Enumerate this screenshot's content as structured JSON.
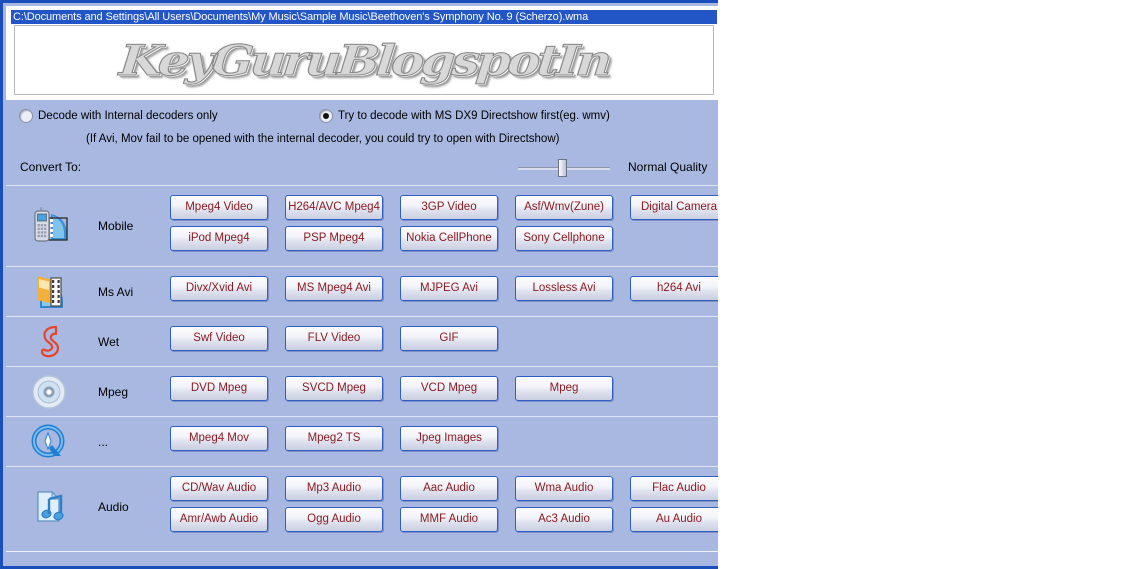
{
  "window": {
    "title_path": "C:\\Documents and Settings\\All Users\\Documents\\My Music\\Sample Music\\Beethoven's Symphony No. 9 (Scherzo).wma",
    "watermark": "KeyGuruBlogspotIn",
    "accent_color": "#2255c5",
    "border_color": "#1a4fbb",
    "panel_color": "#a8b8e0",
    "button_text_color": "#8b1a22"
  },
  "options": {
    "internal_decoder": {
      "label": "Decode with Internal decoders only",
      "checked": false
    },
    "directshow_decoder": {
      "label": "Try to decode with MS DX9 Directshow first(eg. wmv)",
      "checked": true
    },
    "hint": "(If Avi, Mov fail to be opened with the internal decoder, you could try to open with Directshow)",
    "convert_to_label": "Convert To:",
    "quality_label": "Normal Quality",
    "quality_slider_percent": 48
  },
  "categories": [
    {
      "name": "Mobile",
      "icon": "mobile-phone-film-icon",
      "rows": [
        [
          "Mpeg4 Video",
          "H264/AVC Mpeg4",
          "3GP Video",
          "Asf/Wmv(Zune)",
          "Digital Camera"
        ],
        [
          "iPod Mpeg4",
          "PSP Mpeg4",
          "Nokia CellPhone",
          "Sony Cellphone"
        ]
      ]
    },
    {
      "name": "Ms Avi",
      "icon": "avi-film-icon",
      "rows": [
        [
          "Divx/Xvid Avi",
          "MS Mpeg4 Avi",
          "MJPEG Avi",
          "Lossless Avi",
          "h264 Avi"
        ]
      ]
    },
    {
      "name": "Wet",
      "icon": "flash-icon",
      "rows": [
        [
          "Swf Video",
          "FLV Video",
          "GIF"
        ]
      ]
    },
    {
      "name": "Mpeg",
      "icon": "disc-icon",
      "rows": [
        [
          "DVD Mpeg",
          "SVCD Mpeg",
          "VCD Mpeg",
          "Mpeg"
        ]
      ]
    },
    {
      "name": "...",
      "icon": "quicktime-icon",
      "rows": [
        [
          "Mpeg4 Mov",
          "Mpeg2 TS",
          "Jpeg Images"
        ]
      ]
    },
    {
      "name": "Audio",
      "icon": "audio-note-icon",
      "rows": [
        [
          "CD/Wav Audio",
          "Mp3 Audio",
          "Aac Audio",
          "Wma Audio",
          "Flac Audio"
        ],
        [
          "Amr/Awb Audio",
          "Ogg  Audio",
          "MMF Audio",
          "Ac3 Audio",
          "Au  Audio"
        ]
      ]
    }
  ]
}
